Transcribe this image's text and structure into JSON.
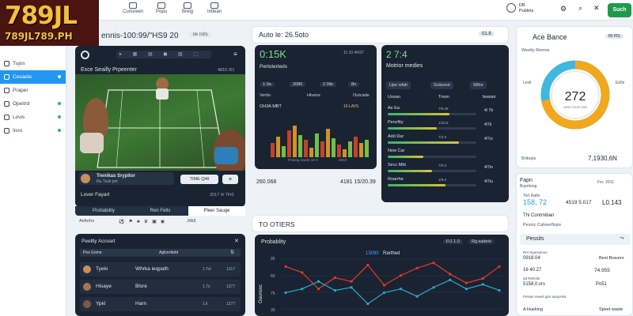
{
  "logo": {
    "top": "789JL",
    "bottom": "789JL789.PH"
  },
  "topnav": [
    {
      "label": "Cunsreen"
    },
    {
      "label": "Popu"
    },
    {
      "label": "Brelg"
    },
    {
      "label": "Intlean"
    }
  ],
  "user": {
    "name": "DB",
    "sub": "Publets"
  },
  "search_button": "Such",
  "sidebar": [
    {
      "label": "Tujos",
      "active": false
    },
    {
      "label": "Cesaela",
      "active": true
    },
    {
      "label": "Praper",
      "active": false
    },
    {
      "label": "Opeitrd",
      "active": false
    },
    {
      "label": "Lovis",
      "active": false
    },
    {
      "label": "Iisro",
      "active": false
    }
  ],
  "main_title": "ennis-100:99/\"HS9 20",
  "main_title_tag": "ile rolls",
  "video": {
    "title": "Exce Seailly Prpeenter",
    "score": "4816 /61",
    "player_name": "Trenikas Srypitor",
    "player_sub": "Ru Tusk pm",
    "time": "TIME Ql4I",
    "caption": "Lover Fayart",
    "caption_val": "2017 4/ 7Fi0",
    "tabs": [
      "Probability",
      "Ren Felts",
      "Pleer Sauge"
    ],
    "stats_label": "Aeforhs",
    "stats_val": "J/tk5"
  },
  "left_table": {
    "title": "Peeltly Accvart",
    "headers": [
      "Pes Gome",
      "Agfcerttebt"
    ],
    "rows": [
      {
        "name": "Tyeki",
        "desc": "Whrka ieqpath",
        "v1": "1.Tol",
        "v2": "1317"
      },
      {
        "name": "Hisaye",
        "desc": "Blsre",
        "v1": "1.7s",
        "v2": "1377"
      },
      {
        "name": "Ypkl",
        "desc": "Harn",
        "v1": "1.ll",
        "v2": "1277"
      }
    ]
  },
  "auto_title": "Auto le: 26.5oto",
  "auto_tag": "01.8",
  "p1": {
    "value": "0:15K",
    "sub": "11:10 46/07",
    "label": "Pertolerteds",
    "pills": [
      "1:3a",
      "2080",
      "2 0ils",
      "8n"
    ],
    "cols": [
      "Vertio",
      "Hlvens",
      "Outcade"
    ],
    "stat_label": "OH3A MBT",
    "stat_val": "16 LAVS",
    "foot": "Pranng lowrts 10 0",
    "foot_val": "2013",
    "bottom_a": "260.068",
    "bottom_b": "4181 15/20.39"
  },
  "p2": {
    "value": "2 7:4",
    "label": "Motrior medies",
    "pills": [
      "Upe wfalt",
      "Gobsoot",
      "Wihe"
    ],
    "cols": [
      "Uosan",
      "Tresn",
      "boeian"
    ],
    "rows": [
      {
        "label": "Ae Ea",
        "mid": "7/9.48",
        "right": "4/ 7b",
        "pct": 70
      },
      {
        "label": "Pencfity",
        "mid": "1/43.8",
        "right": "4/7ii",
        "pct": 55
      },
      {
        "label": "Add Dar",
        "mid": "7/2.6",
        "right": "4/7xi",
        "pct": 80
      },
      {
        "label": "New Car",
        "mid": "",
        "right": "",
        "pct": 40
      },
      {
        "label": "Secc Mbt",
        "mid": "7/0.0",
        "right": "4/7io",
        "pct": 50
      },
      {
        "label": "Roarrhe",
        "mid": "1/9.0",
        "right": "4/7iu",
        "pct": 65
      }
    ]
  },
  "ace": {
    "title": "Ace Bance",
    "tag": "RI RS",
    "sub": "Weelty Rennis",
    "legend_l": "Levll",
    "legend_r": "Eit0s",
    "value": "272",
    "value_sub": "ARN TOUR FAR",
    "foot": "Brltoqls",
    "foot_val": "7,1930,6N",
    "ring_pct": 72
  },
  "right2": {
    "label": "Fapn",
    "sub": "Bupritong",
    "date": "Fer. 2011",
    "stat1": "Tort Ratts",
    "stat1_val": "158, 72",
    "stat2": "4519 5.017",
    "stat3": "L0.143",
    "row": "Thi Contrniban",
    "row_sub": "Pesnic Cahoerftops",
    "sect": "Pessits",
    "r1": "Ret Sigesamos",
    "r1_val": "0918.04",
    "r1_right": "Best Bravers",
    "r2": "16 40.27",
    "r2_right": "74.955",
    "r2_sub": "ad Riehole",
    "r2_val": "5158,0,vrs",
    "r2_r": "Po51",
    "r3": "Pelsan Hwed ppn aaupHsa",
    "r4": "A Hueking",
    "r4_right": "Speet waste"
  },
  "others": {
    "title": "TO OTIERS"
  },
  "prob": {
    "title": "Probablity",
    "tag": "Fi1 1.0",
    "tag2": "Rg sadeie",
    "legend_a": "13090",
    "legend_b": "Rarthed",
    "ylabel": "Oaunsnc",
    "yticks": [
      "95",
      "80",
      "75",
      "30"
    ]
  },
  "chart_data": {
    "type": "line",
    "series": [
      {
        "name": "",
        "color": "#e23a2e",
        "values": [
          90,
          82,
          60,
          75,
          70,
          92,
          65,
          78,
          88,
          95,
          80,
          68,
          74,
          90
        ]
      },
      {
        "name": "",
        "color": "#2fa9c7",
        "values": [
          55,
          60,
          70,
          58,
          62,
          40,
          55,
          60,
          50,
          62,
          72,
          60,
          66,
          58
        ]
      }
    ],
    "ylim": [
      30,
      100
    ]
  }
}
